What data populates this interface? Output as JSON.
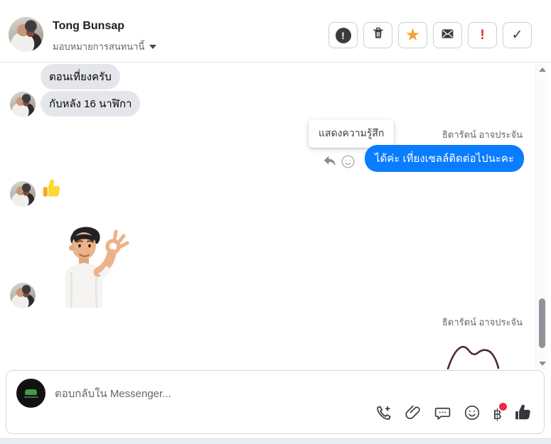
{
  "header": {
    "contact_name": "Tong Bunsap",
    "assign_conversation_label": "มอบหมายการสนทนานี้",
    "glyphs": {
      "alert": "!",
      "star": "★",
      "exclamation": "!",
      "check": "✓"
    },
    "action_icons": [
      "alert-circle-icon",
      "trash-icon",
      "star-icon",
      "envelope-icon",
      "exclamation-icon",
      "check-icon"
    ]
  },
  "chat": {
    "incoming_message_1": "ตอนเที่ยงครับ",
    "incoming_message_2": "กับหลัง 16 นาฬิกา",
    "reaction_tooltip": "แสดงความรู้สึก",
    "customer_name": "ธิดารัตน์ อาจประจัน",
    "outgoing_message": "ได้ค่ะ เที่ยงเซลล์ติดต่อไปนะคะ",
    "thumb_reaction_emoji": "👍",
    "sticker_description": "3d-avatar-ok-hand-sticker"
  },
  "composer": {
    "placeholder": "ตอบกลับใน Messenger...",
    "baht_symbol": "฿",
    "tool_icons": [
      "phone-plus-icon",
      "paperclip-icon",
      "chat-dots-icon",
      "emoji-smile-icon",
      "baht-payment-icon",
      "like-thumb-icon"
    ]
  },
  "colors": {
    "outgoing_bubble": "#0a7cff",
    "incoming_bubble": "#e4e6eb",
    "star_orange": "#f5a33b",
    "alert_red": "#d93025",
    "notification_dot": "#f02849"
  }
}
